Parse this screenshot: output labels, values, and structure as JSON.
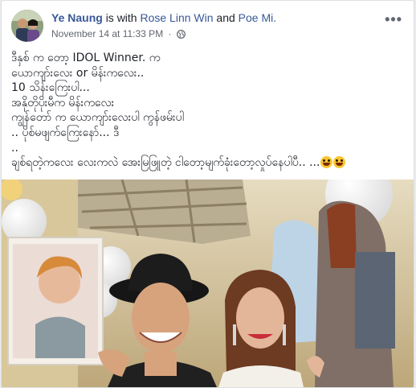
{
  "post": {
    "author": "Ye Naung",
    "with_text": "is with",
    "tagged1": "Rose Linn Win",
    "and_text": "and",
    "tagged2": "Poe Mi.",
    "date": "November 14 at 11:33 PM",
    "separator": "·",
    "privacy_icon": "globe-icon",
    "more_icon": "more-options-icon",
    "more_label": "•••",
    "text_lines": [
      "ဒီနှစ် က တော့ IDOL Winner. က",
      "ယောကျာ်းလေး or မိန်းကလေး..",
      "10 သိန်းကြေးပါ...",
      "အနိုတိုပိုးမီက မိန်းကလေး",
      "ကျွန်တော် က ယောကျာ်းလေးပါ ကွန်ဖမ်းပါ",
      ".. ပိုစ်မဖျက်ကြေးနော်... ဒီ",
      "..",
      "ချစ်ရတဲ့ကလေး လေးကလဲ အေးမြဖြူတဲ့ ငါတော့မျက်ခုံးတော့လှုပ်နေပါပီ.. ..."
    ],
    "photo_icon": "post-photo"
  },
  "colors": {
    "link": "#385898",
    "text": "#1d2129",
    "meta": "#616770",
    "background": "#e9ebee"
  }
}
